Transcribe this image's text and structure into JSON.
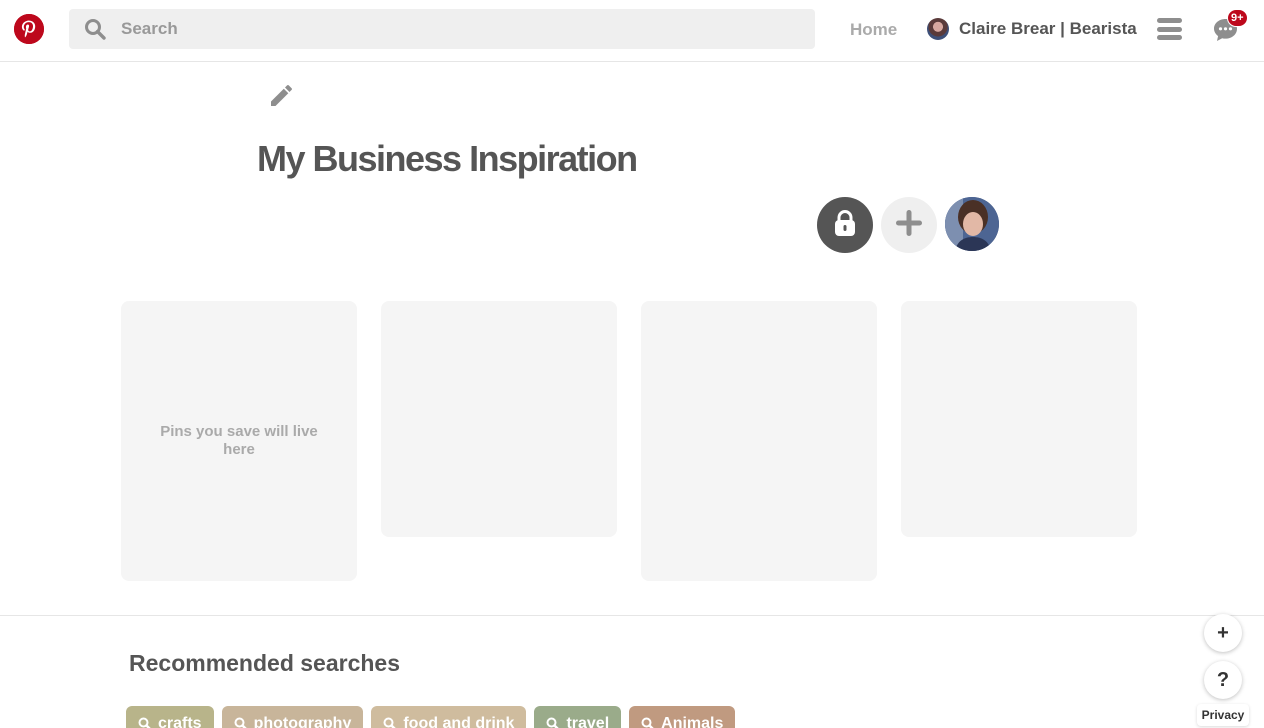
{
  "header": {
    "search_placeholder": "Search",
    "home_label": "Home",
    "user_name": "Claire Brear | Bearista",
    "notification_count": "9+"
  },
  "board": {
    "title": "My Business Inspiration",
    "empty_message": "Pins you save will live here"
  },
  "recommended": {
    "title": "Recommended searches",
    "chips": [
      {
        "label": "crafts",
        "color": "#b8b48a"
      },
      {
        "label": "photography",
        "color": "#c8b59a"
      },
      {
        "label": "food and drink",
        "color": "#cfbc9e"
      },
      {
        "label": "travel",
        "color": "#9aab8a"
      },
      {
        "label": "Animals",
        "color": "#c09a80"
      }
    ]
  },
  "floating": {
    "add_label": "+",
    "help_label": "?",
    "privacy_label": "Privacy"
  },
  "colors": {
    "brand": "#bd081c"
  },
  "icons": {
    "logo": "pinterest-logo-icon",
    "search": "search-icon",
    "menu": "menu-icon",
    "chat": "chat-icon",
    "edit": "pencil-icon",
    "lock": "lock-icon",
    "add_collaborator": "plus-icon"
  }
}
